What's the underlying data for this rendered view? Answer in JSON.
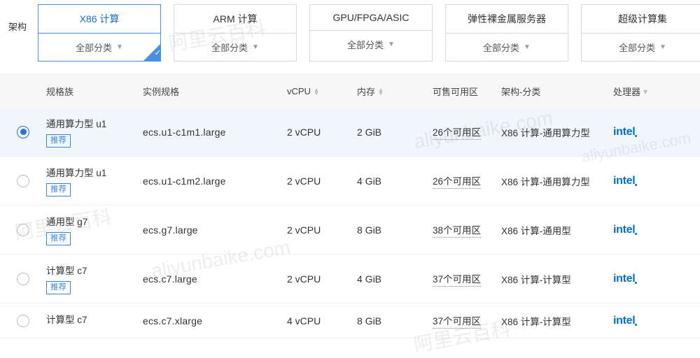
{
  "arch_label": "架构",
  "arch_tabs": [
    {
      "title": "X86 计算",
      "select": "全部分类",
      "active": true
    },
    {
      "title": "ARM 计算",
      "select": "全部分类",
      "active": false
    },
    {
      "title": "GPU/FPGA/ASIC",
      "select": "全部分类",
      "active": false
    },
    {
      "title": "弹性裸金属服务器",
      "select": "全部分类",
      "active": false
    },
    {
      "title": "超级计算集",
      "select": "全部分类",
      "active": false
    }
  ],
  "columns": {
    "family": "规格族",
    "spec": "实例规格",
    "vcpu": "vCPU",
    "mem": "内存",
    "zone": "可售可用区",
    "archcat": "架构-分类",
    "proc": "处理器"
  },
  "reco_tag": "推荐",
  "rows": [
    {
      "selected": true,
      "family": "通用算力型 u1",
      "reco": true,
      "spec": "ecs.u1-c1m1.large",
      "vcpu": "2 vCPU",
      "mem": "2 GiB",
      "zone": "26个可用区",
      "archcat": "X86 计算-通用算力型",
      "proc": "intel"
    },
    {
      "selected": false,
      "family": "通用算力型 u1",
      "reco": true,
      "spec": "ecs.u1-c1m2.large",
      "vcpu": "2 vCPU",
      "mem": "4 GiB",
      "zone": "26个可用区",
      "archcat": "X86 计算-通用算力型",
      "proc": "intel"
    },
    {
      "selected": false,
      "family": "通用型 g7",
      "reco": true,
      "spec": "ecs.g7.large",
      "vcpu": "2 vCPU",
      "mem": "8 GiB",
      "zone": "38个可用区",
      "archcat": "X86 计算-通用型",
      "proc": "intel"
    },
    {
      "selected": false,
      "family": "计算型 c7",
      "reco": true,
      "spec": "ecs.c7.large",
      "vcpu": "2 vCPU",
      "mem": "4 GiB",
      "zone": "37个可用区",
      "archcat": "X86 计算-计算型",
      "proc": "intel"
    },
    {
      "selected": false,
      "family": "计算型 c7",
      "reco": false,
      "spec": "ecs.c7.xlarge",
      "vcpu": "4 vCPU",
      "mem": "8 GiB",
      "zone": "37个可用区",
      "archcat": "X86 计算-计算型",
      "proc": "intel"
    }
  ],
  "watermark": [
    "阿里云百科",
    "aliyunbaike.com"
  ]
}
